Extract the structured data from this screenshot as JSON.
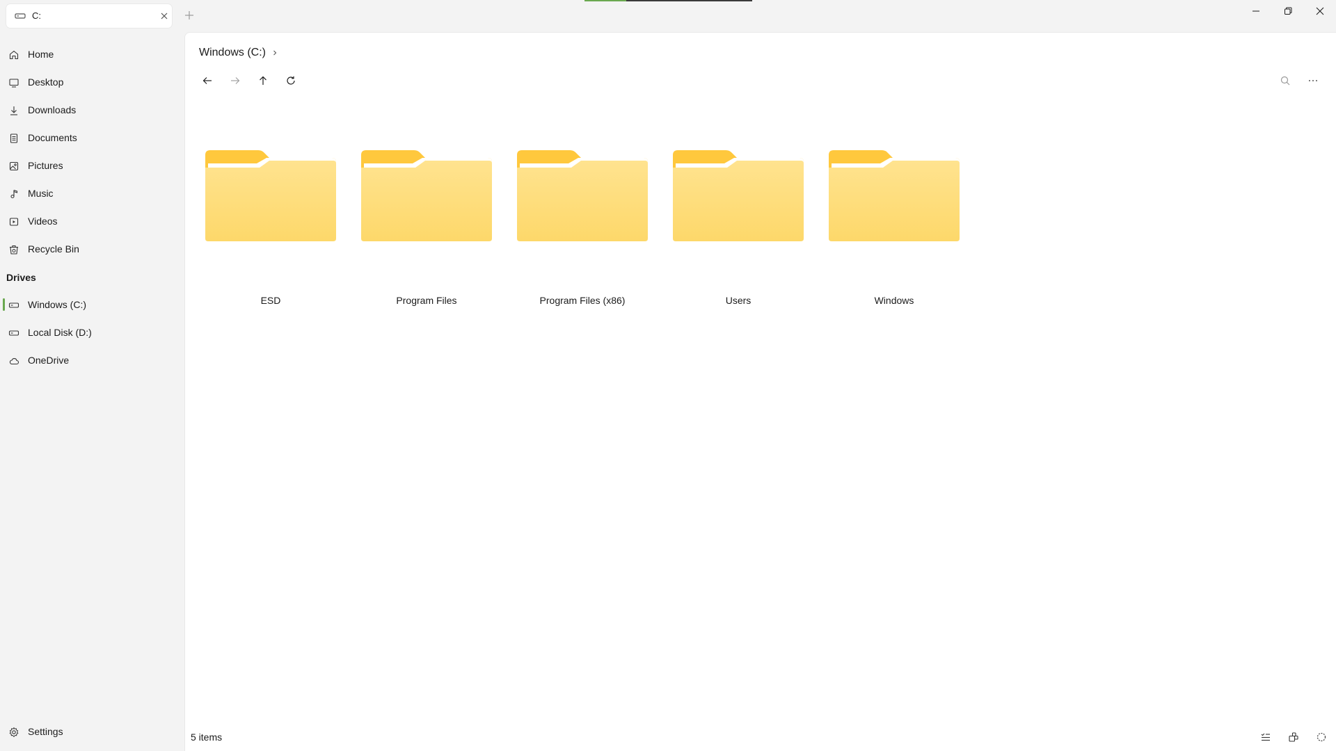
{
  "tab": {
    "label": "C:",
    "icon": "drive-icon"
  },
  "progress": 0.25,
  "sidebar": {
    "items": [
      {
        "label": "Home",
        "icon": "home-icon"
      },
      {
        "label": "Desktop",
        "icon": "desktop-icon"
      },
      {
        "label": "Downloads",
        "icon": "download-icon"
      },
      {
        "label": "Documents",
        "icon": "document-icon"
      },
      {
        "label": "Pictures",
        "icon": "picture-icon"
      },
      {
        "label": "Music",
        "icon": "music-icon"
      },
      {
        "label": "Videos",
        "icon": "video-icon"
      },
      {
        "label": "Recycle Bin",
        "icon": "recycle-bin-icon"
      }
    ],
    "drives_header": "Drives",
    "drives": [
      {
        "label": "Windows (C:)",
        "icon": "drive-icon",
        "active": true
      },
      {
        "label": "Local Disk (D:)",
        "icon": "drive-icon",
        "active": false
      },
      {
        "label": "OneDrive",
        "icon": "cloud-icon",
        "active": false
      }
    ],
    "settings_label": "Settings"
  },
  "breadcrumb": {
    "current": "Windows (C:)"
  },
  "folders": [
    {
      "name": "ESD"
    },
    {
      "name": "Program Files"
    },
    {
      "name": "Program Files (x86)"
    },
    {
      "name": "Users"
    },
    {
      "name": "Windows"
    }
  ],
  "status": {
    "item_count": "5 items"
  },
  "colors": {
    "accent": "#6aa84f",
    "folder_front": "#ffe089",
    "folder_back": "#ffc83d"
  }
}
